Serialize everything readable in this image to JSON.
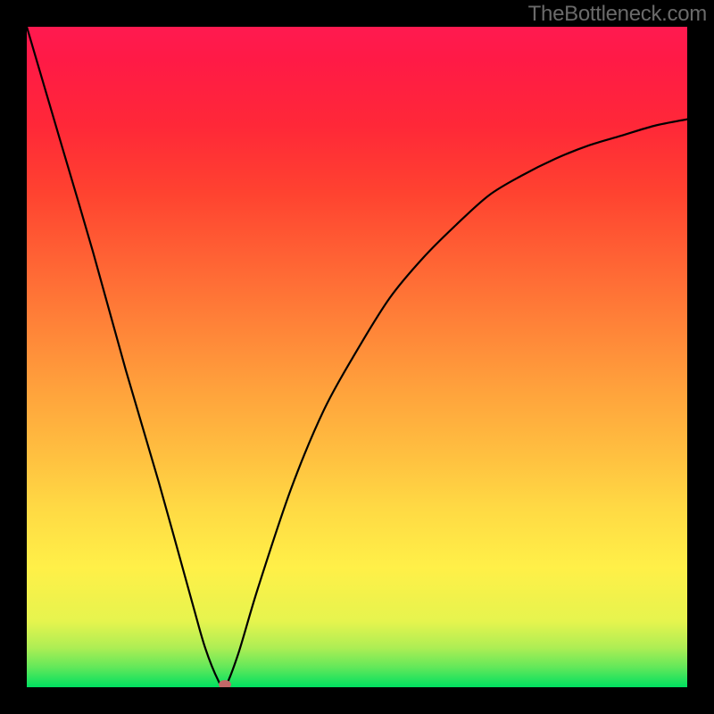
{
  "watermark": "TheBottleneck.com",
  "chart_data": {
    "type": "line",
    "title": "",
    "xlabel": "",
    "ylabel": "",
    "xlim": [
      0,
      100
    ],
    "ylim": [
      0,
      100
    ],
    "series": [
      {
        "name": "bottleneck-curve",
        "x": [
          0,
          5,
          10,
          15,
          20,
          25,
          27,
          29,
          30,
          32,
          35,
          40,
          45,
          50,
          55,
          60,
          65,
          70,
          75,
          80,
          85,
          90,
          95,
          100
        ],
        "y": [
          100,
          83,
          66,
          48,
          31,
          13,
          6,
          1,
          0,
          5,
          15,
          30,
          42,
          51,
          59,
          65,
          70,
          74.5,
          77.5,
          80,
          82,
          83.5,
          85,
          86
        ]
      }
    ],
    "minimum_point": {
      "x": 30,
      "y": 0
    },
    "background_gradient": {
      "top": "#ff1a50",
      "bottom": "#00e060"
    },
    "grid": false,
    "legend": false
  }
}
